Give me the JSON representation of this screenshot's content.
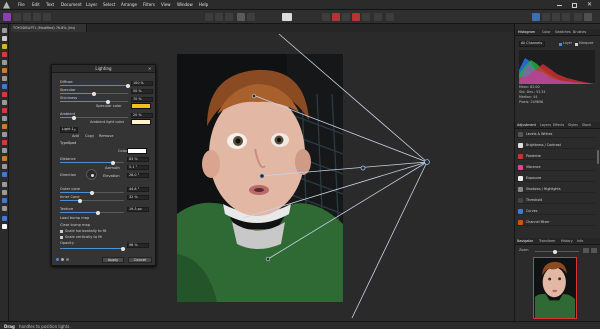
{
  "menubar": {
    "items": [
      "File",
      "Edit",
      "Text",
      "Document",
      "Layer",
      "Select",
      "Arrange",
      "Filters",
      "View",
      "Window",
      "Help"
    ]
  },
  "document": {
    "tab_title": "TOYOSIBILPTL (Modified) 76.8% (Iris)"
  },
  "dialog": {
    "title": "Lighting",
    "diffuse": {
      "label": "Diffuse",
      "value": "100 %",
      "fraction": 1.0
    },
    "specular": {
      "label": "Specular",
      "value": "50 %",
      "fraction": 0.5
    },
    "shininess": {
      "label": "Shininess",
      "value": "70 %",
      "fraction": 0.7
    },
    "specular_color_label": "Specular color",
    "ambient": {
      "label": "Ambient",
      "value": "20 %",
      "fraction": 0.2
    },
    "ambient_light_color_label": "Ambient light color",
    "light_select": "Light 1",
    "light_buttons": [
      "Add",
      "Copy",
      "Remove"
    ],
    "type_label": "Type",
    "type_value": "Spot",
    "color_label": "Color",
    "distance": {
      "label": "Distance",
      "value": "83 %",
      "fraction": 0.83
    },
    "direction_label": "Direction",
    "azimuth": {
      "label": "Azimuth",
      "value": "5.1 °"
    },
    "elevation": {
      "label": "Elevation",
      "value": "28.0 °"
    },
    "outer_cone": {
      "label": "Outer cone",
      "value": "44.8 °",
      "fraction": 0.5
    },
    "inner_cone": {
      "label": "Inner Cone",
      "value": "32 %",
      "fraction": 0.32
    },
    "texture": {
      "label": "Texture",
      "value": "19.3 px",
      "fraction": 0.6
    },
    "load_bump_map": "Load bump map",
    "clear_bump_map": "Clear bump map",
    "scale_horizontally": "Scale horizontally to fit",
    "scale_vertically": "Scale vertically to fit",
    "opacity": {
      "label": "Opacity",
      "value": "98 %",
      "fraction": 0.98
    },
    "apply": "Apply",
    "cancel": "Cancel"
  },
  "histogram_panel": {
    "tabs": [
      "Histogram",
      "Color",
      "Swatches",
      "Brushes"
    ],
    "channel": "All Channels",
    "options": [
      "Layer",
      "Marquee"
    ],
    "stats": [
      "Mean: 62.00",
      "Std. Dev.: 53.34",
      "Median: 44",
      "Pixels: 249696"
    ]
  },
  "adjustment_panel": {
    "tabs": [
      "Adjustment",
      "Layers",
      "Effects",
      "Styles",
      "Stock"
    ],
    "items": [
      "Levels & Whites",
      "Brightness / Contrast",
      "Posterize",
      "Vibrance",
      "Exposure",
      "Shadows / Highlights",
      "Threshold",
      "Curves",
      "Channel Mixer"
    ]
  },
  "navigator_panel": {
    "tabs": [
      "Navigator",
      "Transform",
      "History",
      "Info"
    ],
    "zoom_label": "Zoom"
  },
  "status": {
    "bold": "Drag",
    "text": "handles to position lights."
  },
  "colors": {
    "specular_color": "#f1c21b",
    "ambient_color": "#fff4cc",
    "light_color": "#ffffff",
    "accent": "#4a8fd8"
  }
}
